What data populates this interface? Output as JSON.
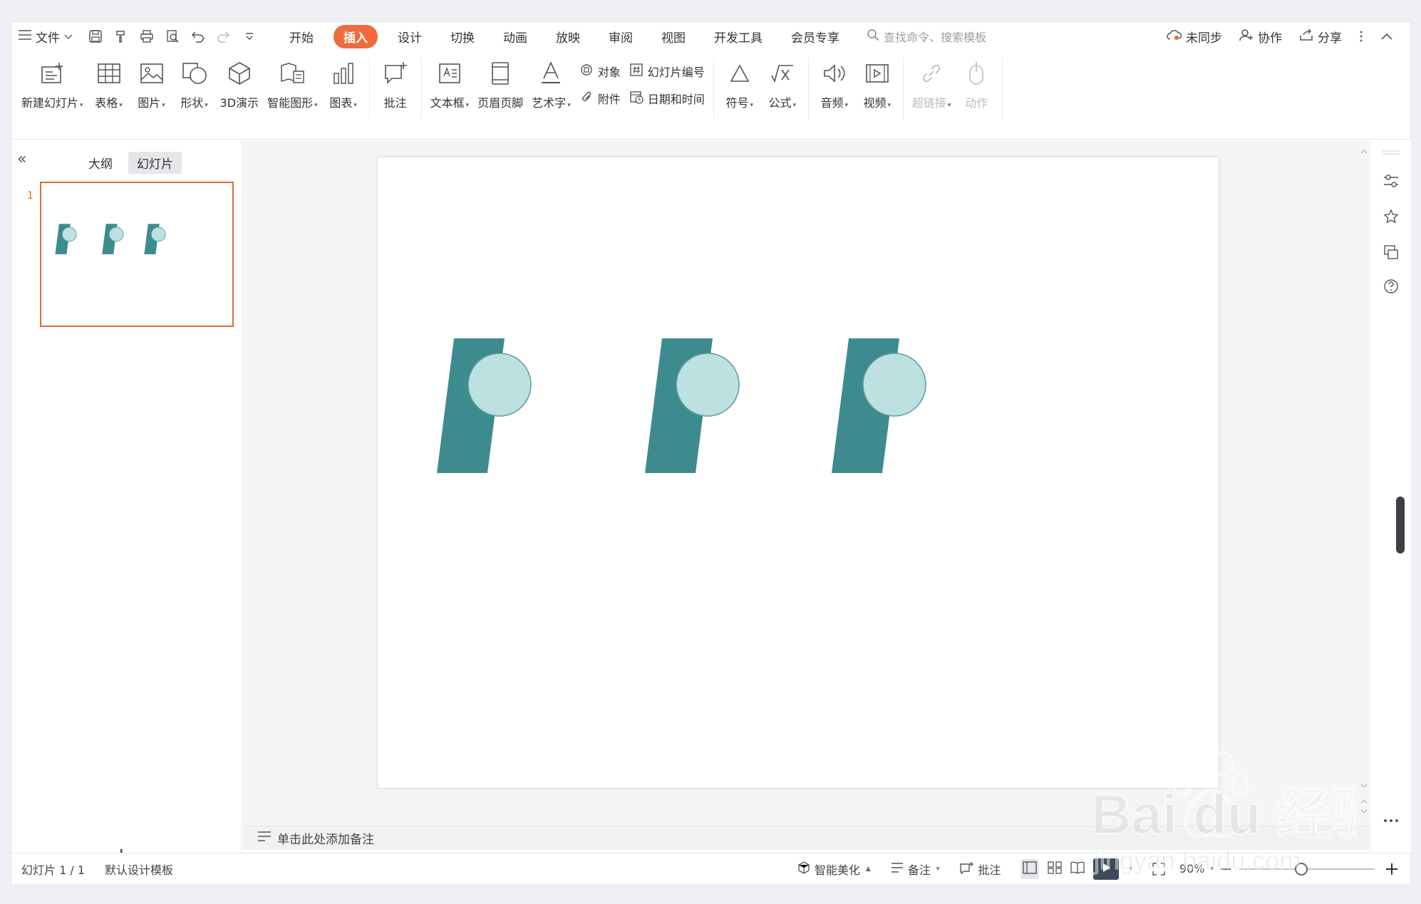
{
  "menu": {
    "hamburger_label": "文件",
    "tabs": [
      "开始",
      "插入",
      "设计",
      "切换",
      "动画",
      "放映",
      "审阅",
      "视图",
      "开发工具",
      "会员专享"
    ],
    "active_tab_index": 1,
    "search_placeholder": "查找命令、搜索模板",
    "sync_label": "未同步",
    "collab_label": "协作",
    "share_label": "分享"
  },
  "ribbon": {
    "new_slide": "新建幻灯片",
    "table": "表格",
    "picture": "图片",
    "shape": "形状",
    "demo3d": "3D演示",
    "smartart": "智能图形",
    "chart": "图表",
    "comment": "批注",
    "textbox": "文本框",
    "header_footer": "页眉页脚",
    "wordart": "艺术字",
    "object": "对象",
    "attachment": "附件",
    "slide_number": "幻灯片编号",
    "date_time": "日期和时间",
    "symbol": "符号",
    "formula": "公式",
    "audio": "音频",
    "video": "视频",
    "hyperlink": "超链接",
    "action": "动作"
  },
  "left_panel": {
    "tab_outline": "大纲",
    "tab_slides": "幻灯片",
    "thumb_number": "1"
  },
  "notes": {
    "placeholder": "单击此处添加备注"
  },
  "status": {
    "slide_count": "幻灯片 1 / 1",
    "template": "默认设计模板",
    "beautify": "智能美化",
    "notes": "备注",
    "comment": "批注",
    "zoom": "90%"
  },
  "colors": {
    "accent": "#ef6b3e",
    "teal": "#3e8b8f",
    "light_teal": "#bde0e1"
  },
  "watermark": {
    "logo": "Bai du 经验",
    "url": "jingyan.baidu.com"
  }
}
